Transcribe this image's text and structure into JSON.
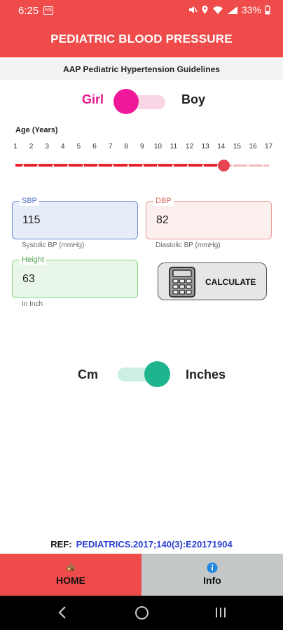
{
  "status_bar": {
    "time": "6:25",
    "left_icon": "NS",
    "battery": "33%",
    "icons": [
      "mute-icon",
      "location-icon",
      "wifi-icon",
      "signal-icon",
      "battery-icon"
    ]
  },
  "app_bar": {
    "title": "PEDIATRIC BLOOD PRESSURE"
  },
  "subtitle": "AAP Pediatric Hypertension Guidelines",
  "gender": {
    "left_label": "Girl",
    "right_label": "Boy",
    "selected": "Girl"
  },
  "age": {
    "label": "Age (Years)",
    "ticks": [
      "1",
      "2",
      "3",
      "4",
      "5",
      "6",
      "7",
      "8",
      "9",
      "10",
      "11",
      "12",
      "13",
      "14",
      "15",
      "16",
      "17"
    ],
    "min": 1,
    "max": 17,
    "value": 14
  },
  "sbp": {
    "legend": "SBP",
    "value": "115",
    "hint": "Systolic BP (mmHg)"
  },
  "dbp": {
    "legend": "DBP",
    "value": "82",
    "hint": "Diastolic BP (mmHg)"
  },
  "height": {
    "legend": "Height",
    "value": "63",
    "hint": "In Inch"
  },
  "calculate": {
    "label": "CALCULATE"
  },
  "units": {
    "left_label": "Cm",
    "right_label": "Inches",
    "selected": "Inches"
  },
  "reference": {
    "label": "REF:",
    "link": "PEDIATRICS.2017;140(3):E20171904"
  },
  "tabs": [
    {
      "label": "HOME",
      "active": true,
      "icon": "home-icon"
    },
    {
      "label": "Info",
      "active": false,
      "icon": "info-icon"
    }
  ],
  "colors": {
    "primary_red": "#f04b4b",
    "girl_pink": "#f0189a",
    "unit_green": "#1eb58e",
    "link_blue": "#2a3ed2"
  }
}
